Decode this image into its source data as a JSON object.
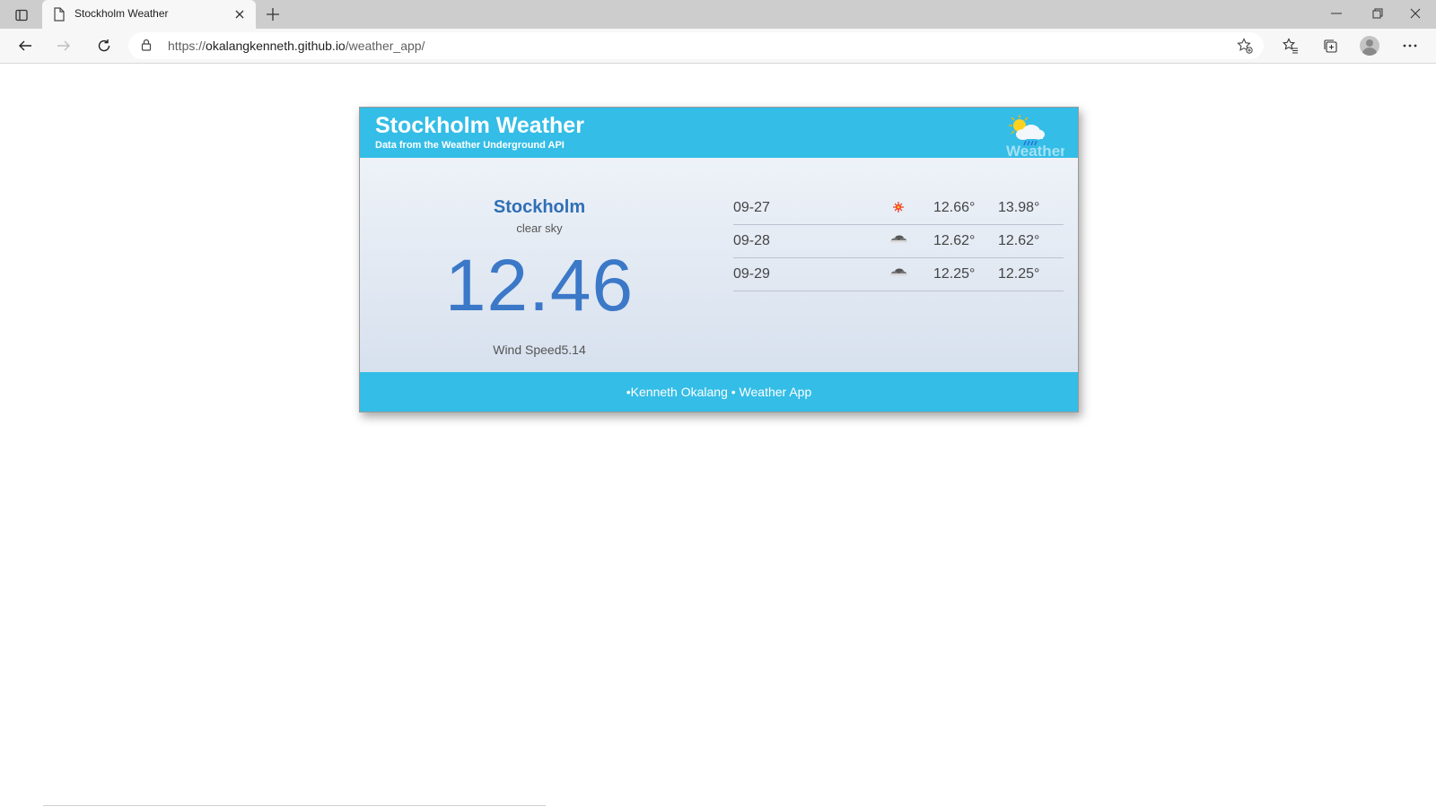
{
  "browser": {
    "tab": {
      "title": "Stockholm Weather"
    },
    "address": {
      "scheme": "https://",
      "host": "okalangkenneth.github.io",
      "path": "/weather_app/"
    }
  },
  "header": {
    "title": "Stockholm Weather",
    "subtitle": "Data from the Weather Underground API",
    "logo_text": "Weather"
  },
  "current": {
    "city": "Stockholm",
    "description": "clear sky",
    "temperature": "12.46",
    "wind": "Wind Speed5.14"
  },
  "forecast": [
    {
      "date": "09-27",
      "icon": "sun-icon",
      "min": "12.66°",
      "max": "13.98°"
    },
    {
      "date": "09-28",
      "icon": "cloud-icon",
      "min": "12.62°",
      "max": "12.62°"
    },
    {
      "date": "09-29",
      "icon": "cloud-icon",
      "min": "12.25°",
      "max": "12.25°"
    }
  ],
  "footer": {
    "text": "•Kenneth Okalang • Weather App"
  },
  "colors": {
    "header_bg": "#34bde6",
    "accent_blue": "#3b78c8"
  }
}
